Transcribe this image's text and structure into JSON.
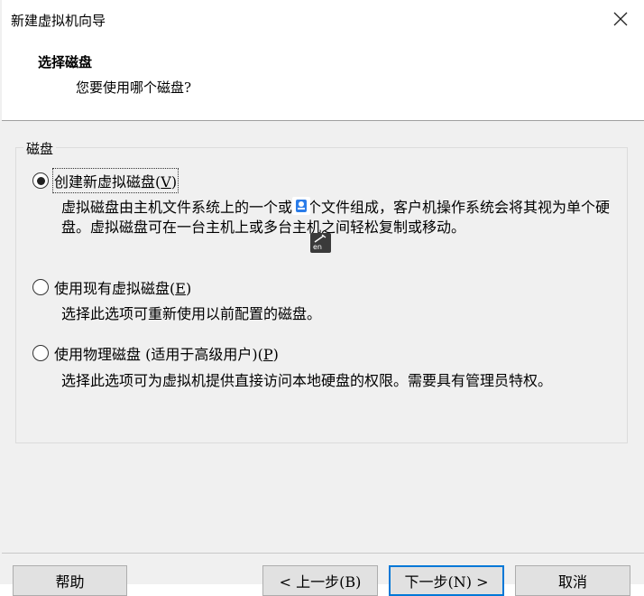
{
  "window": {
    "title": "新建虚拟机向导"
  },
  "header": {
    "title": "选择磁盘",
    "subtitle": "您要使用哪个磁盘?"
  },
  "group": {
    "legend": "磁盘"
  },
  "options": [
    {
      "label": "创建新虚拟磁盘(",
      "key": "V",
      "suffix": ")",
      "selected": true,
      "description": "虚拟磁盘由主机文件系统上的一个或多个文件组成，客户机操作系统会将其视为单个硬盘。虚拟磁盘可在一台主机上或多台主机之间轻松复制或移动。"
    },
    {
      "label": "使用现有虚拟磁盘(",
      "key": "E",
      "suffix": ")",
      "selected": false,
      "description": "选择此选项可重新使用以前配置的磁盘。"
    },
    {
      "label": "使用物理磁盘 (适用于高级用户)(",
      "key": "P",
      "suffix": ")",
      "selected": false,
      "description": "选择此选项可为虚拟机提供直接访问本地硬盘的权限。需要具有管理员特权。"
    }
  ],
  "buttons": {
    "help": "帮助",
    "back": "< 上一步(B)",
    "next": "下一步(N) >",
    "cancel": "取消"
  },
  "ime": {
    "label": "en"
  }
}
